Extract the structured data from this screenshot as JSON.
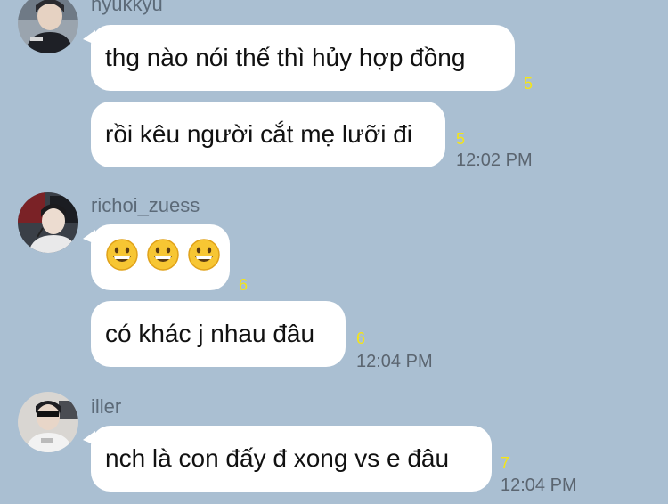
{
  "colors": {
    "background": "#aabfd2",
    "bubble": "#ffffff",
    "unread": "#f5e516",
    "meta": "#5c6a78"
  },
  "messages": [
    {
      "sender": "hyukkyu",
      "avatar_icon": "user-photo-icon",
      "bubbles": [
        {
          "text": "thg nào nói thế thì hủy hợp đồng",
          "unread": "5"
        },
        {
          "text": "rồi kêu người cắt mẹ lưỡi đi",
          "unread": "5",
          "time": "12:02 PM"
        }
      ]
    },
    {
      "sender": "richoi_zuess",
      "avatar_icon": "user-photo-icon",
      "bubbles": [
        {
          "emoji": [
            "grinning-face-emoji",
            "grinning-face-emoji",
            "grinning-face-emoji"
          ],
          "unread": "6"
        },
        {
          "text": "có khác j nhau đâu",
          "unread": "6",
          "time": "12:04 PM"
        }
      ]
    },
    {
      "sender": "iller",
      "avatar_icon": "user-photo-icon",
      "bubbles": [
        {
          "text": "nch là con đấy đ xong vs e đâu",
          "unread": "7",
          "time": "12:04 PM"
        }
      ]
    }
  ]
}
